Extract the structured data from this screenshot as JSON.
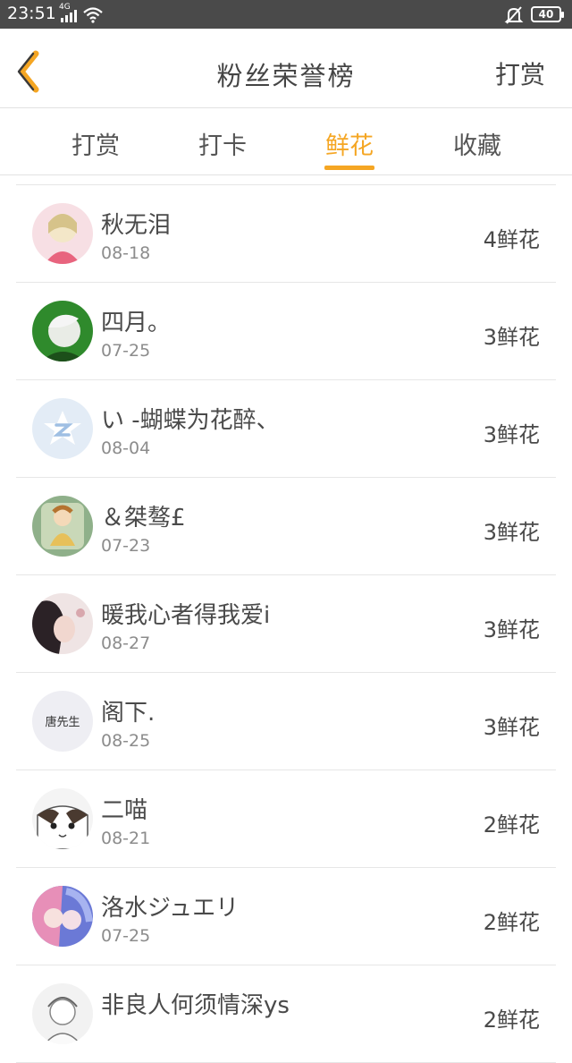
{
  "status_bar": {
    "time": "23:51",
    "network": "4G",
    "battery": "40"
  },
  "header": {
    "title": "粉丝荣誉榜",
    "right_action": "打赏",
    "back_icon": "chevron-left-icon"
  },
  "tabs": [
    {
      "label": "打赏",
      "active": false
    },
    {
      "label": "打卡",
      "active": false
    },
    {
      "label": "鲜花",
      "active": true
    },
    {
      "label": "收藏",
      "active": false
    }
  ],
  "accent_color": "#f5a623",
  "fans": [
    {
      "name": "秋无泪",
      "date": "08-18",
      "count": "4鲜花"
    },
    {
      "name": "四月。",
      "date": "07-25",
      "count": "3鲜花"
    },
    {
      "name": "い -蝴蝶为花醉、",
      "date": "08-04",
      "count": "3鲜花"
    },
    {
      "name": "＆桀骜£",
      "date": "07-23",
      "count": "3鲜花"
    },
    {
      "name": "暖我心者得我爱i",
      "date": "08-27",
      "count": "3鲜花"
    },
    {
      "name": "阁下.",
      "date": "08-25",
      "count": "3鲜花",
      "avatar_text": "唐先生"
    },
    {
      "name": "二喵",
      "date": "08-21",
      "count": "2鲜花"
    },
    {
      "name": "洛水ジュエリ",
      "date": "07-25",
      "count": "2鲜花"
    },
    {
      "name": "非良人何须情深ys",
      "date": "",
      "count": "2鲜花"
    }
  ]
}
